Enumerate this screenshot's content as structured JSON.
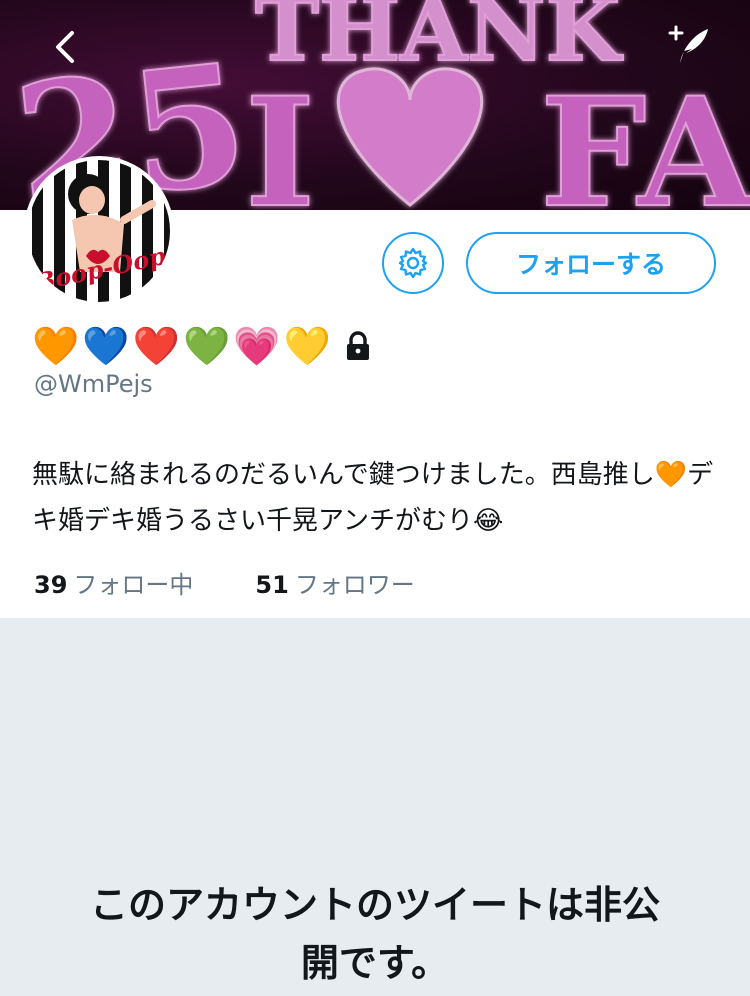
{
  "header": {
    "banner_text": [
      "25",
      "THANK",
      "I",
      "FA"
    ],
    "icons": {
      "back": "chevron-left-icon",
      "compose": "quill-plus-icon"
    }
  },
  "profile": {
    "avatar_text": "Boop-Oop",
    "display_name_emojis": [
      "🧡",
      "💙",
      "❤️",
      "💚",
      "💗",
      "💛"
    ],
    "lock_icon": "lock-icon",
    "handle": "@WmPejs",
    "bio_line1": "無駄に絡まれるのだるいんで鍵つけました。西島推し🧡デ",
    "bio_line2": "キ婚デキ婚うるさい千晃アンチがむり😂",
    "following_count": "39",
    "following_label": "フォロー中",
    "followers_count": "51",
    "followers_label": "フォロワー"
  },
  "actions": {
    "settings_icon": "gear-icon",
    "follow_label": "フォローする"
  },
  "private_notice": {
    "line1": "このアカウントのツイートは非公",
    "line2": "開です。"
  },
  "colors": {
    "accent": "#1da1f2",
    "background": "#e6ecf0",
    "text_primary": "#14171a",
    "text_secondary": "#657786",
    "banner_pink": "#e070d8"
  }
}
